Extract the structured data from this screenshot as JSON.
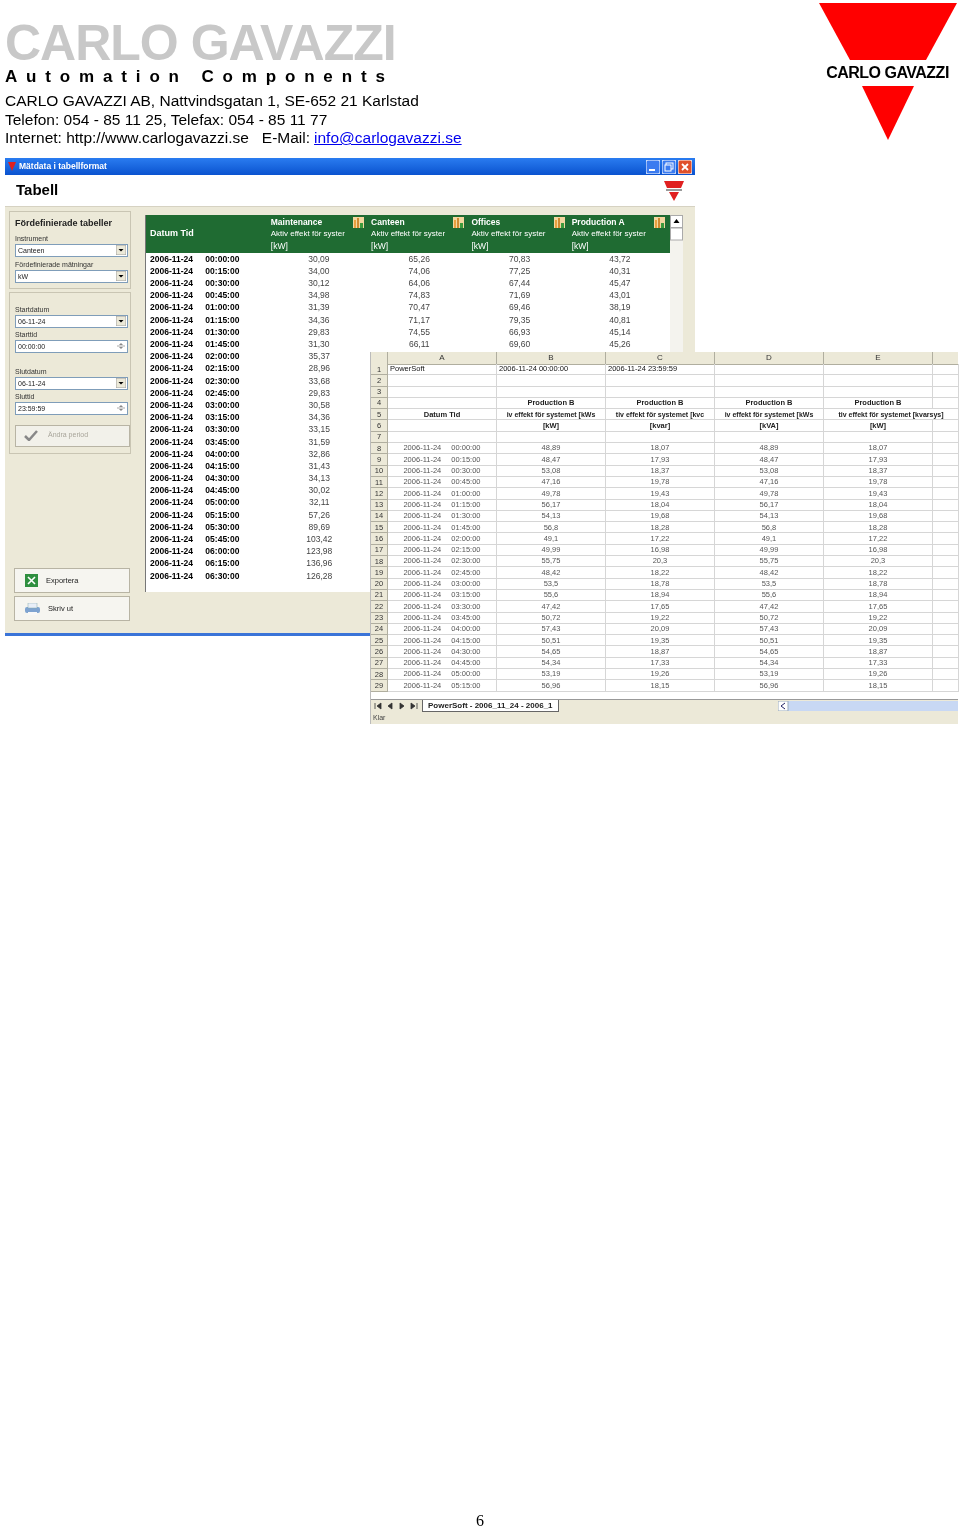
{
  "letterhead": {
    "wordmark": "CARLO GAVAZZI",
    "tagline": "Automation Components",
    "address": "CARLO GAVAZZI AB, Nattvindsgatan 1, SE-652 21 Karlstad",
    "phone": "Telefon: 054 - 85 11 25, Telefax: 054 - 85 11 77",
    "internet": "Internet: http://www.carlogavazzi.se",
    "email_label": "E-Mail:",
    "email": "info@carlogavazzi.se"
  },
  "brand_logo": {
    "text": "CARLO GAVAZZI"
  },
  "app_window": {
    "title": "Mätdata i tabellformat",
    "heading": "Tabell",
    "sidebar": {
      "section_title": "Fördefinierade tabeller",
      "preset_fields": [
        {
          "label": "Instrument",
          "kind": "select",
          "value": "Canteen"
        },
        {
          "label": "Fördefinierade mätningar",
          "kind": "select",
          "value": "kW"
        }
      ],
      "period_fields": [
        {
          "label": "Startdatum",
          "kind": "select",
          "value": "06-11-24"
        },
        {
          "label": "Starttid",
          "kind": "spin",
          "value": "00:00:00"
        },
        {
          "label": "Slutdatum",
          "kind": "select",
          "value": "06-11-24"
        },
        {
          "label": "Sluttid",
          "kind": "spin",
          "value": "23:59:59"
        }
      ],
      "period_button": {
        "label": "Ändra period",
        "disabled": true
      },
      "actions": [
        {
          "label": "Exportera",
          "kind": "export"
        },
        {
          "label": "Skriv ut",
          "kind": "print"
        }
      ]
    },
    "table": {
      "first_column": "Datum Tid",
      "columns": [
        {
          "name": "Maintenance",
          "measure": "Aktiv effekt för syster",
          "unit": "[kW]"
        },
        {
          "name": "Canteen",
          "measure": "Aktiv effekt för syster",
          "unit": "[kW]"
        },
        {
          "name": "Offices",
          "measure": "Aktiv effekt för syster",
          "unit": "[kW]"
        },
        {
          "name": "Production A",
          "measure": "Aktiv effekt för syster",
          "unit": "[kW]"
        }
      ],
      "rows": [
        {
          "datetime": "2006-11-24 00:00:00",
          "values": [
            "30,09",
            "65,26",
            "70,83",
            "43,72"
          ]
        },
        {
          "datetime": "2006-11-24 00:15:00",
          "values": [
            "34,00",
            "74,06",
            "77,25",
            "40,31"
          ]
        },
        {
          "datetime": "2006-11-24 00:30:00",
          "values": [
            "30,12",
            "64,06",
            "67,44",
            "45,47"
          ]
        },
        {
          "datetime": "2006-11-24 00:45:00",
          "values": [
            "34,98",
            "74,83",
            "71,69",
            "43,01"
          ]
        },
        {
          "datetime": "2006-11-24 01:00:00",
          "values": [
            "31,39",
            "70,47",
            "69,46",
            "38,19"
          ]
        },
        {
          "datetime": "2006-11-24 01:15:00",
          "values": [
            "34,36",
            "71,17",
            "79,35",
            "40,81"
          ]
        },
        {
          "datetime": "2006-11-24 01:30:00",
          "values": [
            "29,83",
            "74,55",
            "66,93",
            "45,14"
          ]
        },
        {
          "datetime": "2006-11-24 01:45:00",
          "values": [
            "31,30",
            "66,11",
            "69,60",
            "45,26"
          ]
        },
        {
          "datetime": "2006-11-24 02:00:00",
          "values": [
            "35,37"
          ]
        },
        {
          "datetime": "2006-11-24 02:15:00",
          "values": [
            "28,96"
          ]
        },
        {
          "datetime": "2006-11-24 02:30:00",
          "values": [
            "33,68"
          ]
        },
        {
          "datetime": "2006-11-24 02:45:00",
          "values": [
            "29,83"
          ]
        },
        {
          "datetime": "2006-11-24 03:00:00",
          "values": [
            "30,58"
          ]
        },
        {
          "datetime": "2006-11-24 03:15:00",
          "values": [
            "34,36"
          ]
        },
        {
          "datetime": "2006-11-24 03:30:00",
          "values": [
            "33,15"
          ]
        },
        {
          "datetime": "2006-11-24 03:45:00",
          "values": [
            "31,59"
          ]
        },
        {
          "datetime": "2006-11-24 04:00:00",
          "values": [
            "32,86"
          ]
        },
        {
          "datetime": "2006-11-24 04:15:00",
          "values": [
            "31,43"
          ]
        },
        {
          "datetime": "2006-11-24 04:30:00",
          "values": [
            "34,13"
          ]
        },
        {
          "datetime": "2006-11-24 04:45:00",
          "values": [
            "30,02"
          ]
        },
        {
          "datetime": "2006-11-24 05:00:00",
          "values": [
            "32,11"
          ]
        },
        {
          "datetime": "2006-11-24 05:15:00",
          "values": [
            "57,26"
          ]
        },
        {
          "datetime": "2006-11-24 05:30:00",
          "values": [
            "89,69"
          ]
        },
        {
          "datetime": "2006-11-24 05:45:00",
          "values": [
            "103,42"
          ]
        },
        {
          "datetime": "2006-11-24 06:00:00",
          "values": [
            "123,98"
          ]
        },
        {
          "datetime": "2006-11-24 06:15:00",
          "values": [
            "136,96"
          ]
        },
        {
          "datetime": "2006-11-24 06:30:00",
          "values": [
            "126,28"
          ]
        }
      ]
    }
  },
  "spreadsheet": {
    "columns": [
      "A",
      "B",
      "C",
      "D",
      "E"
    ],
    "rows": [
      {
        "number": "1",
        "kind": "info",
        "cells": [
          "PowerSoft",
          "2006-11-24 00:00:00",
          "2006-11-24 23:59:59"
        ]
      },
      {
        "number": "2",
        "kind": "blank"
      },
      {
        "number": "3",
        "kind": "blank"
      },
      {
        "number": "4",
        "kind": "series",
        "cells": [
          "Production B",
          "Production B",
          "Production B",
          "Production B"
        ]
      },
      {
        "number": "5",
        "kind": "label",
        "cells": [
          "Datum Tid",
          "iv effekt för systemet [kWs",
          "tiv effekt för systemet [kvc",
          "iv effekt för systemet [kWs",
          "tiv effekt för systemet [kvarsys]"
        ]
      },
      {
        "number": "6",
        "kind": "series",
        "cells": [
          "[kW]",
          "[kvar]",
          "[kVA]",
          "[kW]"
        ]
      },
      {
        "number": "7",
        "kind": "blank"
      },
      {
        "number": "8",
        "kind": "data",
        "cells": [
          "2006-11-24 00:00:00",
          "48,89",
          "18,07",
          "48,89",
          "18,07"
        ]
      },
      {
        "number": "9",
        "kind": "data",
        "cells": [
          "2006-11-24 00:15:00",
          "48,47",
          "17,93",
          "48,47",
          "17,93"
        ]
      },
      {
        "number": "10",
        "kind": "data",
        "cells": [
          "2006-11-24 00:30:00",
          "53,08",
          "18,37",
          "53,08",
          "18,37"
        ]
      },
      {
        "number": "11",
        "kind": "data",
        "cells": [
          "2006-11-24 00:45:00",
          "47,16",
          "19,78",
          "47,16",
          "19,78"
        ]
      },
      {
        "number": "12",
        "kind": "data",
        "cells": [
          "2006-11-24 01:00:00",
          "49,78",
          "19,43",
          "49,78",
          "19,43"
        ]
      },
      {
        "number": "13",
        "kind": "data",
        "cells": [
          "2006-11-24 01:15:00",
          "56,17",
          "18,04",
          "56,17",
          "18,04"
        ]
      },
      {
        "number": "14",
        "kind": "data",
        "cells": [
          "2006-11-24 01:30:00",
          "54,13",
          "19,68",
          "54,13",
          "19,68"
        ]
      },
      {
        "number": "15",
        "kind": "data",
        "cells": [
          "2006-11-24 01:45:00",
          "56,8",
          "18,28",
          "56,8",
          "18,28"
        ]
      },
      {
        "number": "16",
        "kind": "data",
        "cells": [
          "2006-11-24 02:00:00",
          "49,1",
          "17,22",
          "49,1",
          "17,22"
        ]
      },
      {
        "number": "17",
        "kind": "data",
        "cells": [
          "2006-11-24 02:15:00",
          "49,99",
          "16,98",
          "49,99",
          "16,98"
        ]
      },
      {
        "number": "18",
        "kind": "data",
        "cells": [
          "2006-11-24 02:30:00",
          "55,75",
          "20,3",
          "55,75",
          "20,3"
        ]
      },
      {
        "number": "19",
        "kind": "data",
        "cells": [
          "2006-11-24 02:45:00",
          "48,42",
          "18,22",
          "48,42",
          "18,22"
        ]
      },
      {
        "number": "20",
        "kind": "data",
        "cells": [
          "2006-11-24 03:00:00",
          "53,5",
          "18,78",
          "53,5",
          "18,78"
        ]
      },
      {
        "number": "21",
        "kind": "data",
        "cells": [
          "2006-11-24 03:15:00",
          "55,6",
          "18,94",
          "55,6",
          "18,94"
        ]
      },
      {
        "number": "22",
        "kind": "data",
        "cells": [
          "2006-11-24 03:30:00",
          "47,42",
          "17,65",
          "47,42",
          "17,65"
        ]
      },
      {
        "number": "23",
        "kind": "data",
        "cells": [
          "2006-11-24 03:45:00",
          "50,72",
          "19,22",
          "50,72",
          "19,22"
        ]
      },
      {
        "number": "24",
        "kind": "data",
        "cells": [
          "2006-11-24 04:00:00",
          "57,43",
          "20,09",
          "57,43",
          "20,09"
        ]
      },
      {
        "number": "25",
        "kind": "data",
        "cells": [
          "2006-11-24 04:15:00",
          "50,51",
          "19,35",
          "50,51",
          "19,35"
        ]
      },
      {
        "number": "26",
        "kind": "data",
        "cells": [
          "2006-11-24 04:30:00",
          "54,65",
          "18,87",
          "54,65",
          "18,87"
        ]
      },
      {
        "number": "27",
        "kind": "data",
        "cells": [
          "2006-11-24 04:45:00",
          "54,34",
          "17,33",
          "54,34",
          "17,33"
        ]
      },
      {
        "number": "28",
        "kind": "data",
        "cells": [
          "2006-11-24 05:00:00",
          "53,19",
          "19,26",
          "53,19",
          "19,26"
        ]
      },
      {
        "number": "29",
        "kind": "data",
        "cells": [
          "2006-11-24 05:15:00",
          "56,96",
          "18,15",
          "56,96",
          "18,15"
        ]
      }
    ],
    "sheet_tab": "PowerSoft - 2006_11_24 - 2006_1",
    "status": "Klar"
  },
  "page_number": "6"
}
